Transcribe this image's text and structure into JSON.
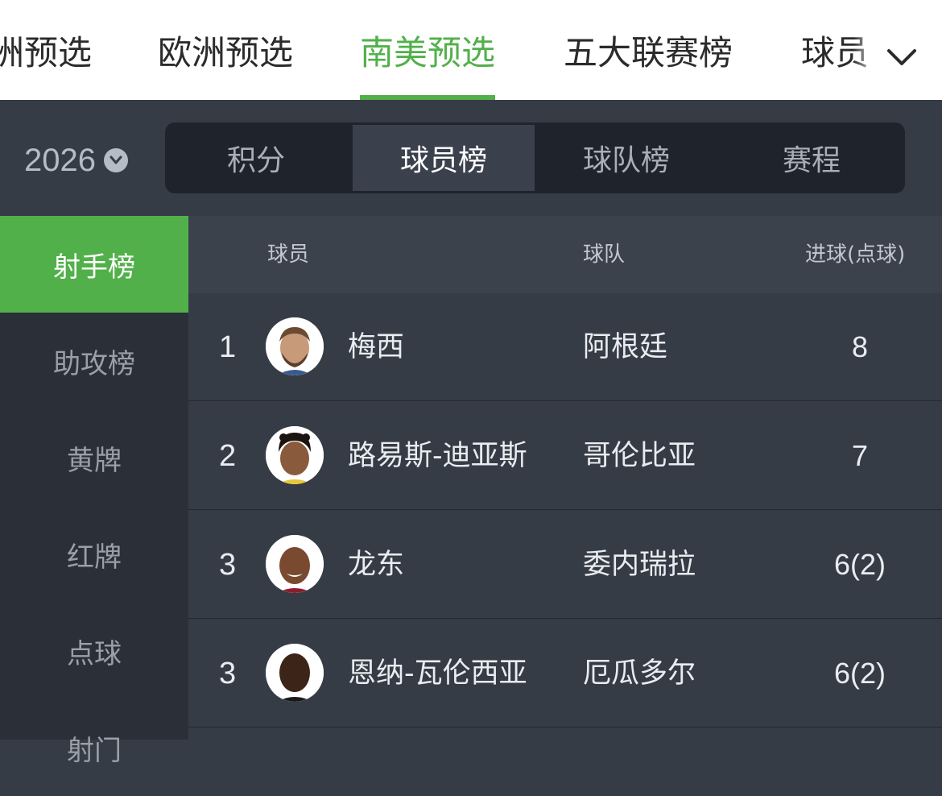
{
  "top_tabs": [
    {
      "label": "洲预选"
    },
    {
      "label": "欧洲预选"
    },
    {
      "label": "南美预选"
    },
    {
      "label": "五大联赛榜"
    },
    {
      "label": "球员"
    }
  ],
  "active_top_tab": "南美预选",
  "season": "2026",
  "segments": [
    "积分",
    "球员榜",
    "球队榜",
    "赛程"
  ],
  "active_segment": "球员榜",
  "sidenav": [
    "射手榜",
    "助攻榜",
    "黄牌",
    "红牌",
    "点球",
    "射门"
  ],
  "active_sidenav": "射手榜",
  "table": {
    "headers": {
      "player": "球员",
      "team": "球队",
      "goals": "进球(点球)"
    },
    "rows": [
      {
        "rank": "1",
        "name": "梅西",
        "team": "阿根廷",
        "goals": "8"
      },
      {
        "rank": "2",
        "name": "路易斯-迪亚斯",
        "team": "哥伦比亚",
        "goals": "7"
      },
      {
        "rank": "3",
        "name": "龙东",
        "team": "委内瑞拉",
        "goals": "6(2)"
      },
      {
        "rank": "3",
        "name": "恩纳-瓦伦西亚",
        "team": "厄瓜多尔",
        "goals": "6(2)"
      }
    ]
  },
  "colors": {
    "accent": "#52b04a",
    "background": "#363c46",
    "sidebar": "#2b3038"
  }
}
